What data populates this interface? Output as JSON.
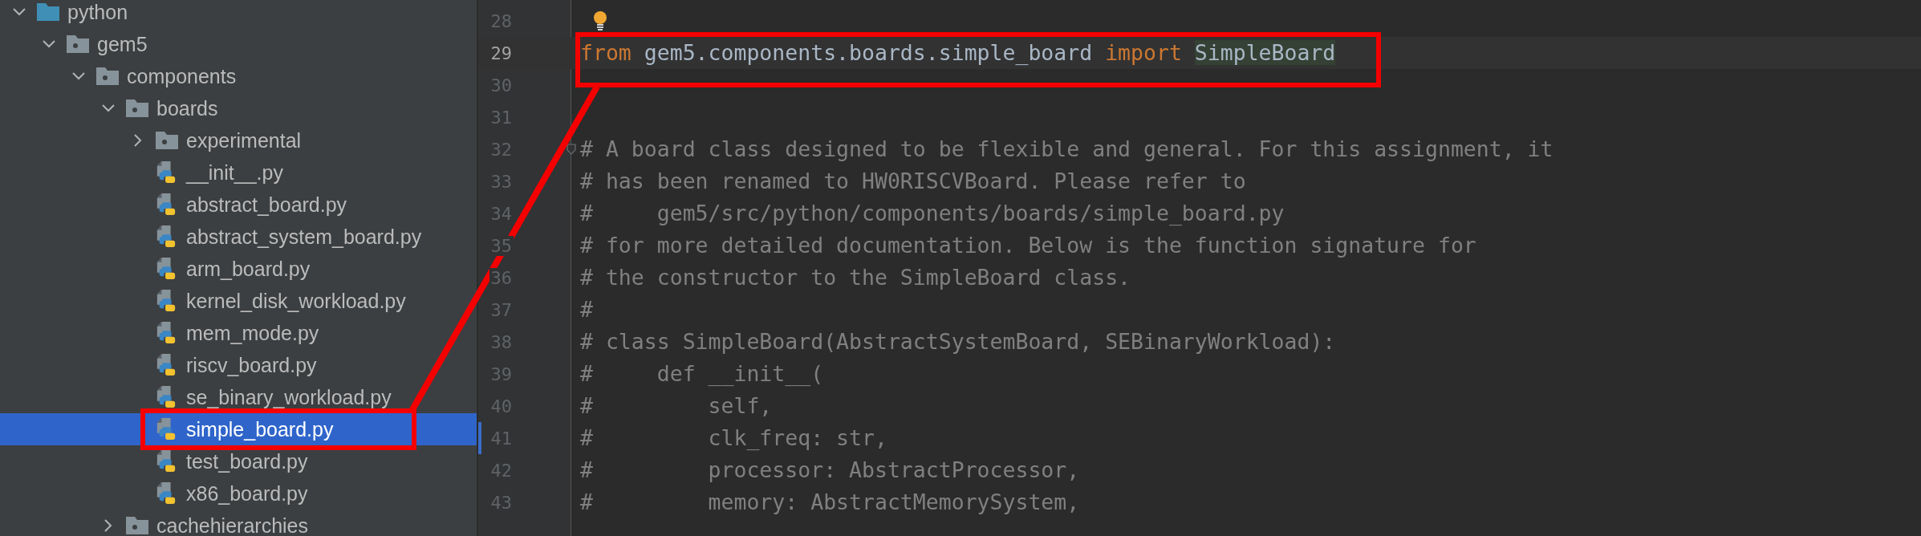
{
  "project_tree": [
    {
      "label": "python",
      "kind": "source_folder",
      "expanded": true,
      "selected": false,
      "children": [
        {
          "label": "gem5",
          "kind": "package",
          "expanded": true,
          "selected": false,
          "children": [
            {
              "label": "components",
              "kind": "package",
              "expanded": true,
              "selected": false,
              "children": [
                {
                  "label": "boards",
                  "kind": "package",
                  "expanded": true,
                  "selected": false,
                  "children": [
                    {
                      "label": "experimental",
                      "kind": "package",
                      "expanded": false,
                      "selected": false
                    },
                    {
                      "label": "__init__.py",
                      "kind": "python_file",
                      "selected": false
                    },
                    {
                      "label": "abstract_board.py",
                      "kind": "python_file",
                      "selected": false
                    },
                    {
                      "label": "abstract_system_board.py",
                      "kind": "python_file",
                      "selected": false
                    },
                    {
                      "label": "arm_board.py",
                      "kind": "python_file",
                      "selected": false
                    },
                    {
                      "label": "kernel_disk_workload.py",
                      "kind": "python_file",
                      "selected": false
                    },
                    {
                      "label": "mem_mode.py",
                      "kind": "python_file",
                      "selected": false
                    },
                    {
                      "label": "riscv_board.py",
                      "kind": "python_file",
                      "selected": false
                    },
                    {
                      "label": "se_binary_workload.py",
                      "kind": "python_file",
                      "selected": false
                    },
                    {
                      "label": "simple_board.py",
                      "kind": "python_file",
                      "selected": true
                    },
                    {
                      "label": "test_board.py",
                      "kind": "python_file",
                      "selected": false
                    },
                    {
                      "label": "x86_board.py",
                      "kind": "python_file",
                      "selected": false
                    }
                  ]
                },
                {
                  "label": "cachehierarchies",
                  "kind": "package",
                  "expanded": false,
                  "selected": false
                }
              ]
            }
          ]
        }
      ]
    }
  ],
  "editor": {
    "lines": [
      {
        "number": "28",
        "bulb": true
      },
      {
        "number": "29",
        "current": true,
        "tokens": [
          {
            "kind": "keyword",
            "text": "from"
          },
          {
            "kind": "plain",
            "text": " gem5.components.boards.simple_board "
          },
          {
            "kind": "keyword",
            "text": "import "
          },
          {
            "kind": "highlighted",
            "text": "SimpleBoard"
          }
        ]
      },
      {
        "number": "30"
      },
      {
        "number": "31"
      },
      {
        "number": "32",
        "fold": true,
        "tokens": [
          {
            "kind": "comment",
            "text": "# A board class designed to be flexible and general. For this assignment, it"
          }
        ]
      },
      {
        "number": "33",
        "tokens": [
          {
            "kind": "comment",
            "text": "# has been renamed to HW0RISCVBoard. Please refer to"
          }
        ]
      },
      {
        "number": "34",
        "tokens": [
          {
            "kind": "comment",
            "text": "#     gem5/src/python/components/boards/simple_board.py"
          }
        ]
      },
      {
        "number": "35",
        "tokens": [
          {
            "kind": "comment",
            "text": "# for more detailed documentation. Below is the function signature for"
          }
        ]
      },
      {
        "number": "36",
        "tokens": [
          {
            "kind": "comment",
            "text": "# the constructor to the SimpleBoard class."
          }
        ]
      },
      {
        "number": "37",
        "tokens": [
          {
            "kind": "comment",
            "text": "#"
          }
        ]
      },
      {
        "number": "38",
        "tokens": [
          {
            "kind": "comment",
            "text": "# class SimpleBoard(AbstractSystemBoard, SEBinaryWorkload):"
          }
        ]
      },
      {
        "number": "39",
        "tokens": [
          {
            "kind": "comment",
            "text": "#     def __init__("
          }
        ]
      },
      {
        "number": "40",
        "tokens": [
          {
            "kind": "comment",
            "text": "#         self,"
          }
        ]
      },
      {
        "number": "41",
        "changed": true,
        "tokens": [
          {
            "kind": "comment",
            "text": "#         clk_freq: str,"
          }
        ]
      },
      {
        "number": "42",
        "tokens": [
          {
            "kind": "comment",
            "text": "#         processor: AbstractProcessor,"
          }
        ]
      },
      {
        "number": "43",
        "tokens": [
          {
            "kind": "comment",
            "text": "#         memory: AbstractMemorySystem,"
          }
        ]
      }
    ]
  }
}
